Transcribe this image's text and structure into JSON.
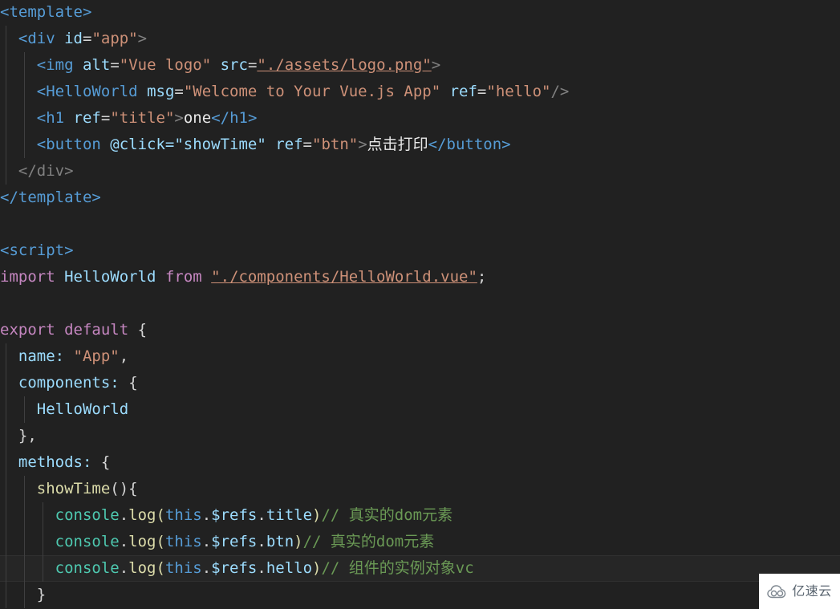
{
  "editor": {
    "language": "vue",
    "background_color": "#212121",
    "current_line_color": "#262626",
    "font_size_px": 19,
    "line_height_px": 33,
    "current_line_number": 21
  },
  "theme_colors": {
    "tag": "#569CD6",
    "punctuation": "#808080",
    "attribute": "#9CDCFE",
    "string": "#CE9178",
    "keyword": "#C586C0",
    "function": "#DCDCAA",
    "object": "#4EC9B0",
    "comment": "#6A9955",
    "text": "#e8e8e8",
    "indent_guide": "#3f3f40"
  },
  "code": {
    "l1": {
      "tag_open": "<template>"
    },
    "l2": {
      "tag": "<div",
      "attr": "id",
      "eq": "=",
      "value": "\"app\"",
      "close": ">"
    },
    "l3": {
      "tag": "<img",
      "attr1": "alt",
      "value1": "\"Vue logo\"",
      "attr2": "src",
      "value2": "\"./assets/logo.png\"",
      "close": ">"
    },
    "l4": {
      "tag": "<HelloWorld",
      "attr1": "msg",
      "value1": "\"Welcome to Your Vue.js App\"",
      "attr2": "ref",
      "value2": "\"hello\"",
      "close": "/>"
    },
    "l5": {
      "tag": "<h1",
      "attr": "ref",
      "value": "\"title\"",
      "gt": ">",
      "text": "one",
      "tag_close": "</h1>"
    },
    "l6": {
      "tag": "<button",
      "directive": "@click=\"showTime\"",
      "attr": "ref",
      "value": "\"btn\"",
      "gt": ">",
      "text": "点击打印",
      "tag_close": "</button>"
    },
    "l7": {
      "tag_close": "</div>"
    },
    "l8": {
      "tag_close": "</template>"
    },
    "l9": {
      "blank": ""
    },
    "l10": {
      "tag_open": "<script>"
    },
    "l11": {
      "kw_import": "import",
      "ident": "HelloWorld",
      "kw_from": "from",
      "value": "\"./components/HelloWorld.vue\"",
      "semi": ";"
    },
    "l12": {
      "blank": ""
    },
    "l13": {
      "kw_export": "export",
      "kw_default": "default",
      "brace": "{"
    },
    "l14": {
      "prop": "name:",
      "value": "\"App\"",
      "comma": ","
    },
    "l15": {
      "prop": "components:",
      "brace": "{"
    },
    "l16": {
      "ident": "HelloWorld"
    },
    "l17": {
      "brace": "},"
    },
    "l18": {
      "prop": "methods:",
      "brace": "{"
    },
    "l19": {
      "fn": "showTime",
      "parens": "()",
      "brace": "{"
    },
    "l20": {
      "obj": "console",
      "dot": ".",
      "fn": "log",
      "lparen": "(",
      "this": "this",
      "dot2": ".",
      "refs": "$refs",
      "dot3": ".",
      "ref": "title",
      "rparen": ")",
      "comment": "// 真实的dom元素"
    },
    "l21": {
      "obj": "console",
      "dot": ".",
      "fn": "log",
      "lparen": "(",
      "this": "this",
      "dot2": ".",
      "refs": "$refs",
      "dot3": ".",
      "ref": "btn",
      "rparen": ")",
      "comment": "// 真实的dom元素"
    },
    "l22": {
      "obj": "console",
      "dot": ".",
      "fn": "log",
      "lparen": "(",
      "this": "this",
      "dot2": ".",
      "refs": "$refs",
      "dot3": ".",
      "ref": "hello",
      "rparen": ")",
      "comment": "// 组件的实例对象vc"
    },
    "l23": {
      "brace": "}"
    }
  },
  "watermark": {
    "label": "亿速云",
    "icon": "cloud-icon",
    "background": "#ffffff",
    "text_color": "#5a6570"
  }
}
